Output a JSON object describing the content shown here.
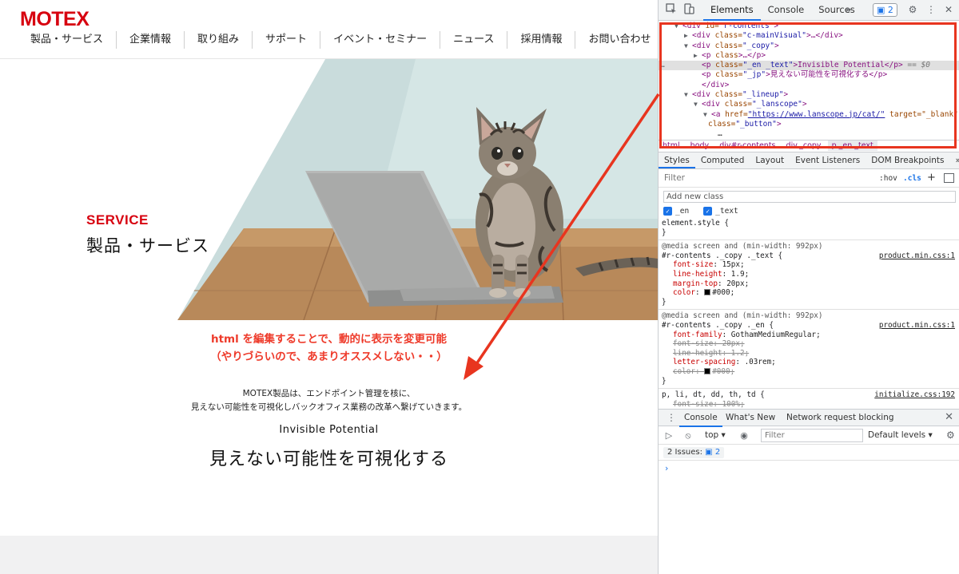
{
  "site": {
    "logo": "MOTEX",
    "nav": [
      "製品・サービス",
      "企業情報",
      "取り組み",
      "サポート",
      "イベント・セミナー",
      "ニュース",
      "採用情報",
      "お問い合わせ"
    ],
    "hero": {
      "label_en": "SERVICE",
      "label_jp": "製品・サービス",
      "image": "cat-with-laptop-photo"
    },
    "annotation": {
      "line1": "html を編集することで、動的に表示を変更可能",
      "line2": "（やりづらいので、あまりオススメしない・・）",
      "color": "#ee3a2a"
    },
    "body": {
      "line1": "MOTEX製品は、エンドポイント管理を核に、",
      "line2": "見えない可能性を可視化しバックオフィス業務の改革へ繋げていきます。"
    },
    "copy_en": "Invisible Potential",
    "copy_jp": "見えない可能性を可視化する",
    "brand_color": "#d7000f"
  },
  "devtools": {
    "tabs": [
      "Elements",
      "Console",
      "Sources"
    ],
    "more": "»",
    "issues_count": "2",
    "dom": [
      {
        "t": "▼",
        "a": "<div ",
        "b": "id=",
        "c": "\"r-contents\"",
        "d": ">"
      },
      {
        "t": "▶",
        "a": "<div ",
        "b": "class=",
        "c": "\"c-mainVisual\"",
        "d": ">…</div>"
      },
      {
        "t": "▼",
        "a": "<div ",
        "b": "class=",
        "c": "\"_copy\"",
        "d": ">"
      },
      {
        "t": "▶",
        "a": "<p ",
        "b": "class",
        "c": "",
        "d": ">…</p>"
      },
      {
        "t": "",
        "a": "<p ",
        "b": "class=",
        "c": "\"_en _text\"",
        "d": ">Invisible Potential</p>",
        "e": " == $0"
      },
      {
        "t": "",
        "a": "<p ",
        "b": "class=",
        "c": "\"_jp\"",
        "d": ">見えない可能性を可視化する</p>"
      },
      {
        "t": "",
        "a": "</div>",
        "b": "",
        "c": "",
        "d": ""
      },
      {
        "t": "▼",
        "a": "<div ",
        "b": "class=",
        "c": "\"_lineup\"",
        "d": ">"
      },
      {
        "t": "▼",
        "a": "<div ",
        "b": "class=",
        "c": "\"_lanscope\"",
        "d": ">"
      },
      {
        "t": "▼",
        "a": "<a ",
        "b": "href=",
        "c": "\"https://www.lanscope.jp/cat/\"",
        "d": " target=\"_blank\""
      },
      {
        "t": "",
        "a": "",
        "b": "class=",
        "c": "\"_button\"",
        "d": ">"
      },
      {
        "t": "",
        "a": "",
        "b": "",
        "c": "",
        "d": "…"
      }
    ],
    "breadcrumbs": [
      "html",
      "body",
      "div#r-contents",
      "div._copy",
      "p._en._text"
    ],
    "style_tabs": [
      "Styles",
      "Computed",
      "Layout",
      "Event Listeners",
      "DOM Breakpoints",
      "»"
    ],
    "filter_placeholder": "Filter",
    "hov": ":hov",
    "cls": ".cls",
    "add_class_placeholder": "Add new class",
    "class_toggles": [
      "_en",
      "_text"
    ],
    "element_style": "element.style {",
    "close_brace": "}",
    "rule1": {
      "media": "@media screen and (min-width: 992px)",
      "selector": "#r-contents ._copy ._text {",
      "source": "product.min.css:1",
      "props": [
        {
          "n": "font-size",
          "v": "15px;"
        },
        {
          "n": "line-height",
          "v": "1.9;"
        },
        {
          "n": "margin-top",
          "v": "20px;"
        },
        {
          "n": "color",
          "v": "#000;"
        }
      ]
    },
    "rule2": {
      "media": "@media screen and (min-width: 992px)",
      "selector": "#r-contents ._copy ._en {",
      "source": "product.min.css:1",
      "props": [
        {
          "n": "font-family",
          "v": "GothamMediumRegular;"
        },
        {
          "n": "font-size",
          "v": "20px;"
        },
        {
          "n": "line-height",
          "v": "1.2;"
        },
        {
          "n": "letter-spacing",
          "v": ".03rem;"
        },
        {
          "n": "color",
          "v": "#000;"
        }
      ]
    },
    "rule3": {
      "selector": "p, li, dt, dd, th, td {",
      "source": "initialize.css:192",
      "props": [
        {
          "n": "font-size",
          "v": "100%;"
        }
      ]
    },
    "drawer_tabs": [
      "Console",
      "What's New",
      "Network request blocking"
    ],
    "console_context": "top ▾",
    "console_filter_placeholder": "Filter",
    "levels": "Default levels ▾",
    "issues_label": "2 Issues:",
    "issues_badge": "2",
    "prompt": "›"
  }
}
